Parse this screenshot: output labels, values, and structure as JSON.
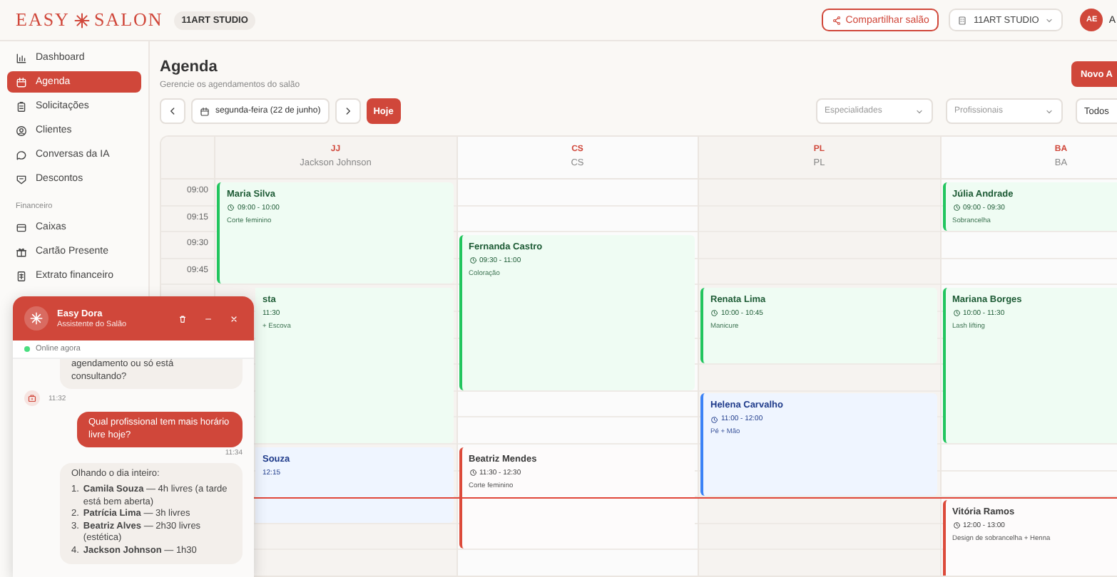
{
  "topbar": {
    "logo_left": "EASY",
    "logo_right": "SALON",
    "studio_badge": "11ART STUDIO",
    "share_button": "Compartilhar salão",
    "studio_select": "11ART STUDIO",
    "avatar": "AE",
    "user_name": "A"
  },
  "sidebar": {
    "items": [
      {
        "label": "Dashboard",
        "selected": false
      },
      {
        "label": "Agenda",
        "selected": true
      },
      {
        "label": "Solicitações",
        "selected": false
      },
      {
        "label": "Clientes",
        "selected": false
      },
      {
        "label": "Conversas da IA",
        "selected": false
      },
      {
        "label": "Descontos",
        "selected": false
      }
    ],
    "section_title": "Financeiro",
    "finance_items": [
      {
        "label": "Caixas",
        "selected": false
      },
      {
        "label": "Cartão Presente",
        "selected": false
      },
      {
        "label": "Extrato financeiro",
        "selected": false
      }
    ]
  },
  "page": {
    "title": "Agenda",
    "subtitle": "Gerencie os agendamentos do salão",
    "new_button": "Novo A",
    "date": "segunda-feira (22 de junho)",
    "today_button": "Hoje",
    "filters": [
      "Especialidades",
      "Profissionais"
    ],
    "all_button": "Todos"
  },
  "calendar": {
    "time_slots": [
      "09:00",
      "09:15",
      "09:30",
      "09:45"
    ],
    "columns": [
      {
        "initials": "JJ",
        "name": "Jackson Johnson",
        "appointments": [
          {
            "client": "Maria Silva",
            "time": "09:00 - 10:00",
            "service": "Corte feminino",
            "kind": "success",
            "covered": false
          },
          {
            "client": "sta",
            "time": "11:30",
            "service": "+ Escova",
            "kind": "success",
            "covered": true
          },
          {
            "client": "Souza",
            "time": "12:15",
            "kind": "info",
            "covered": true
          }
        ]
      },
      {
        "initials": "CS",
        "name": "CS",
        "appointments": [
          {
            "client": "Fernanda Castro",
            "time": "09:30 - 11:00",
            "service": "Coloração",
            "kind": "success",
            "covered": false
          },
          {
            "client": "Beatriz Mendes",
            "time": "11:30 - 12:30",
            "service": "Corte feminino",
            "kind": "danger",
            "covered": false
          }
        ]
      },
      {
        "initials": "PL",
        "name": "PL",
        "appointments": [
          {
            "client": "Renata Lima",
            "time": "10:00 - 10:45",
            "service": "Manicure",
            "kind": "success",
            "covered": false
          },
          {
            "client": "Helena Carvalho",
            "time": "11:00 - 12:00",
            "service": "Pé + Mão",
            "kind": "info",
            "covered": false
          }
        ]
      },
      {
        "initials": "BA",
        "name": "BA",
        "appointments": [
          {
            "client": "Júlia Andrade",
            "time": "09:00 - 09:30",
            "service": "Sobrancelha",
            "kind": "success",
            "covered": false
          },
          {
            "client": "Mariana Borges",
            "time": "10:00 - 11:30",
            "service": "Lash lifting",
            "kind": "success",
            "covered": false
          },
          {
            "client": "Vitória Ramos",
            "time": "12:00 - 13:00",
            "service": "Design de sobrancelha + Henna",
            "kind": "danger",
            "covered": false
          }
        ]
      }
    ]
  },
  "chat": {
    "title": "Easy Dora",
    "subtitle": "Assistente do Salão",
    "status": "Online agora",
    "online": true,
    "messages": [
      {
        "kind": "bot",
        "text": "agendamento ou só está consultando?",
        "time": "11:32"
      },
      {
        "kind": "user",
        "text": "Qual profissional tem mais horário livre hoje?",
        "time": "11:34"
      },
      {
        "kind": "bot",
        "text": "Olhando o dia inteiro:",
        "list": [
          {
            "number": "1.",
            "text": "**Camila Souza** — 4h livres (a tarde está bem aberta)"
          },
          {
            "number": "2.",
            "text": "**Patrícia Lima** — 3h livres"
          },
          {
            "number": "3.",
            "text": "**Beatriz Alves** — 2h30 livres (estética)"
          },
          {
            "number": "4.",
            "text": "**Jackson Johnson** — 1h30"
          }
        ]
      }
    ]
  }
}
